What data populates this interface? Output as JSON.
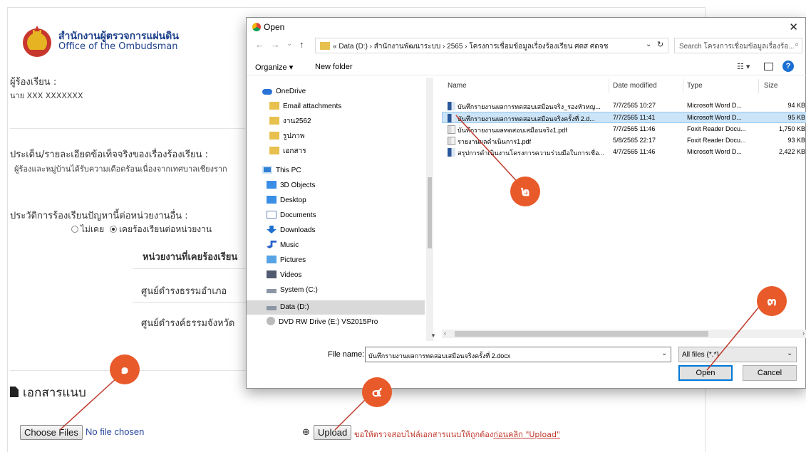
{
  "org": {
    "name_th": "สำนักงานผู้ตรวจการแผ่นดิน",
    "name_en": "Office of the Ombudsman"
  },
  "complainant": {
    "label": "ผู้ร้องเรียน :",
    "value": "นาย XXX   XXXXXXX"
  },
  "facts": {
    "label": "ประเด็น/รายละเอียดข้อเท็จจริงของเรื่องร้องเรียน :",
    "value": "ผู้ร้องและหมู่บ้านได้รับความเดือดร้อนเนื่องจากเทศบาลเชียงราก"
  },
  "history": {
    "label": "ประวัติการร้องเรียนปัญหานี้ต่อหน่วยงานอื่น :",
    "option_never": "ไม่เคย",
    "option_ever": "เคยร้องเรียนต่อหน่วยงาน",
    "table_header": "หน่วยงานที่เคยร้องเรียน",
    "rows": [
      "ศูนย์ดำรงธรรมอำเภอ",
      "ศูนย์ดำรงค์ธรรมจังหวัด"
    ]
  },
  "attachments": {
    "title": "เอกสารแนบ",
    "choose_files": "Choose Files",
    "no_file": "No file chosen",
    "upload": "Upload",
    "note": "ขอให้ตรวจสอบไฟล์เอกสารแนบให้ถูกต้อง",
    "note_link": "ก่อนคลิก \"Upload\""
  },
  "dialog": {
    "title": "Open",
    "close": "✕",
    "address_path": "« Data (D:) › สำนักงานพัฒนาระบบ › 2565 › โครงการเชื่อมข้อมูลเรื่องร้องเรียน ศตส ศดจช",
    "search_placeholder": "Search โครงการเชื่อมข้อมูลเรื่องร้อ...",
    "organize": "Organize ▾",
    "new_folder": "New folder",
    "nav_items": [
      "OneDrive",
      "Email attachments",
      "งาน2562",
      "รูปภาพ",
      "เอกสาร",
      "This PC",
      "3D Objects",
      "Desktop",
      "Documents",
      "Downloads",
      "Music",
      "Pictures",
      "Videos",
      "System (C:)",
      "Data (D:)",
      "DVD RW Drive (E:) VS2015Pro"
    ],
    "columns": {
      "name": "Name",
      "date": "Date modified",
      "type": "Type",
      "size": "Size"
    },
    "files": [
      {
        "name": "บันทึกรายงานผลการทดสอบเสมือนจริง_รองหัวหญ...",
        "date": "7/7/2565 10:27",
        "type": "Microsoft Word D...",
        "size": "94 KB"
      },
      {
        "name": "บันทึกรายงานผลการทดสอบเสมือนจริงครั้งที่ 2.d...",
        "date": "7/7/2565 11:41",
        "type": "Microsoft Word D...",
        "size": "95 KB"
      },
      {
        "name": "บันทึกรายงานผลทดสอบเสมือนจริง1.pdf",
        "date": "7/7/2565 11:46",
        "type": "Foxit Reader Docu...",
        "size": "1,750 KB"
      },
      {
        "name": "รายงานผลดำเนินการ1.pdf",
        "date": "5/8/2565 22:17",
        "type": "Foxit Reader Docu...",
        "size": "93 KB"
      },
      {
        "name": "สรุปการดำเนินงานโครงการความร่วมมือในการเชื่อ...",
        "date": "4/7/2565 11:46",
        "type": "Microsoft Word D...",
        "size": "2,422 KB"
      }
    ],
    "selected_file_index": 1,
    "file_name_label": "File name:",
    "file_name_value": "บันทึกรายงานผลการทดสอบเสมือนจริงครั้งที่ 2.docx",
    "file_filter": "All files (*.*)",
    "open_button": "Open",
    "cancel_button": "Cancel"
  },
  "callouts": [
    "๑",
    "๒",
    "๓",
    "๔"
  ],
  "colors": {
    "callout": "#e85a2a",
    "link_blue": "#1c3f8a",
    "note_red": "#c0392b",
    "selection": "#cce4f7"
  }
}
